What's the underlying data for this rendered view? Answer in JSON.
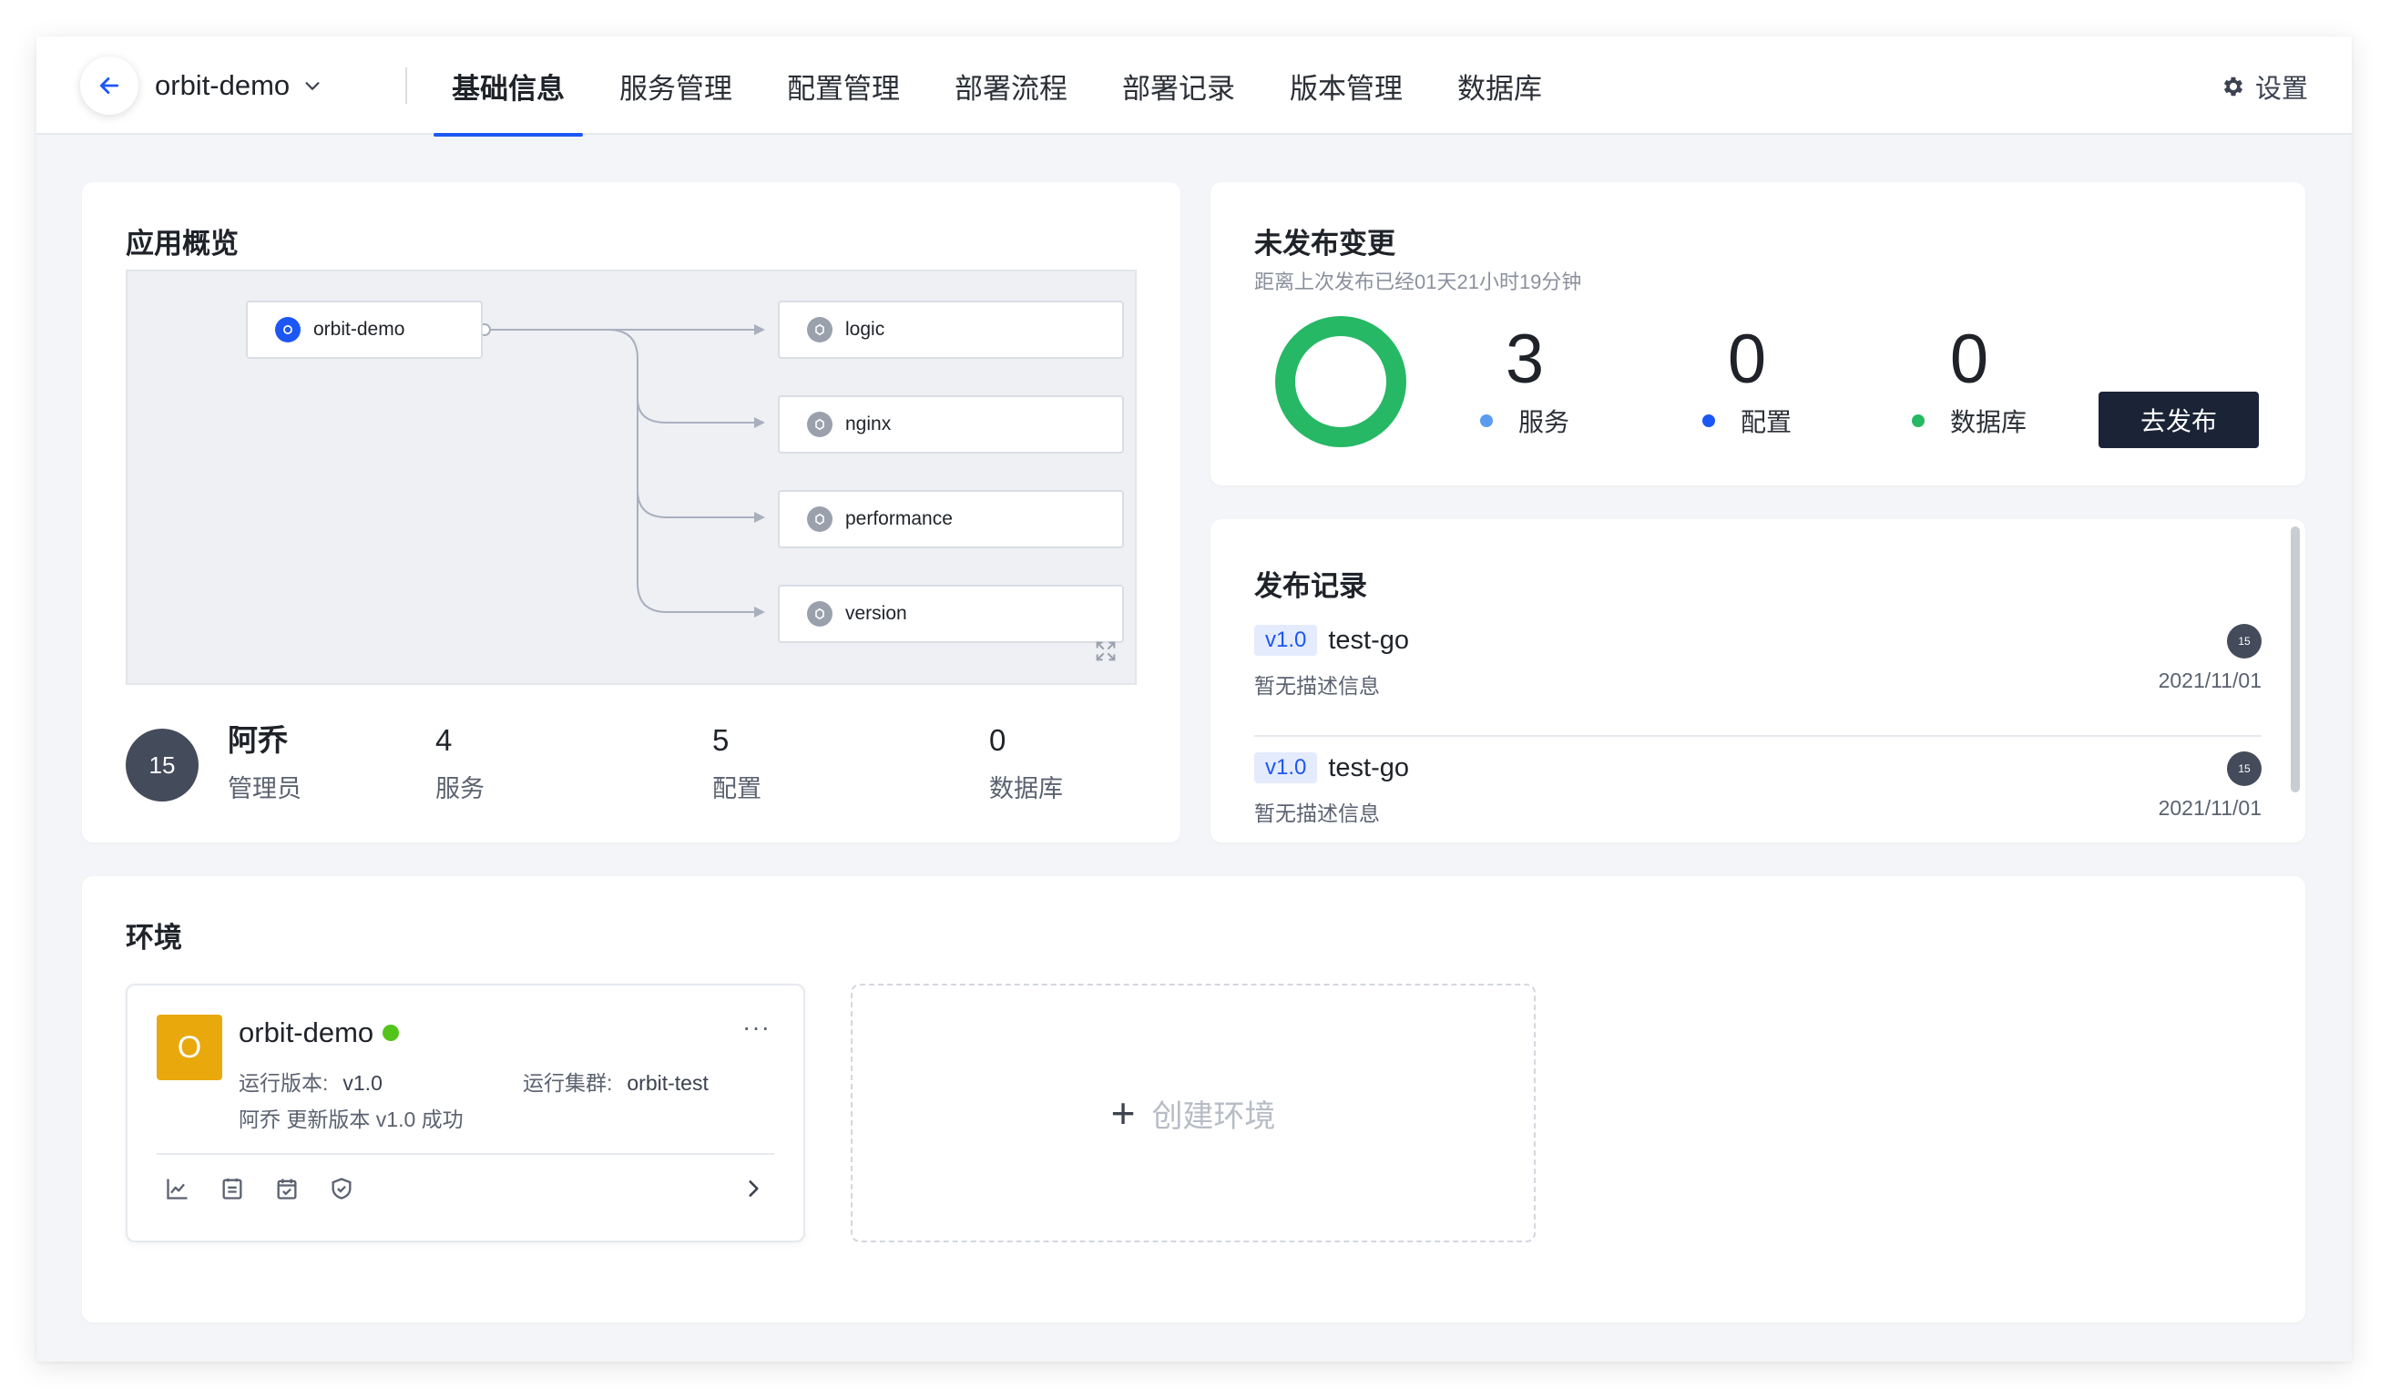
{
  "header": {
    "app_name": "orbit-demo",
    "tabs": [
      {
        "label": "基础信息",
        "active": true
      },
      {
        "label": "服务管理",
        "active": false
      },
      {
        "label": "配置管理",
        "active": false
      },
      {
        "label": "部署流程",
        "active": false
      },
      {
        "label": "部署记录",
        "active": false
      },
      {
        "label": "版本管理",
        "active": false
      },
      {
        "label": "数据库",
        "active": false
      }
    ],
    "settings_label": "设置"
  },
  "overview": {
    "title": "应用概览",
    "diagram": {
      "root": "orbit-demo",
      "children": [
        "logic",
        "nginx",
        "performance",
        "version"
      ]
    },
    "owner": {
      "avatar_text": "15",
      "name": "阿乔",
      "role": "管理员"
    },
    "stats": [
      {
        "value": "4",
        "label": "服务"
      },
      {
        "value": "5",
        "label": "配置"
      },
      {
        "value": "0",
        "label": "数据库"
      }
    ]
  },
  "unreleased": {
    "title": "未发布变更",
    "subtitle": "距离上次发布已经01天21小时19分钟",
    "stats": [
      {
        "value": "3",
        "label": "服务",
        "color": "#5b9cf0"
      },
      {
        "value": "0",
        "label": "配置",
        "color": "#1c57f5"
      },
      {
        "value": "0",
        "label": "数据库",
        "color": "#26b865"
      }
    ],
    "ring_color": "#26b865",
    "publish_button": "去发布"
  },
  "releases": {
    "title": "发布记录",
    "items": [
      {
        "version": "v1.0",
        "name": "test-go",
        "description": "暂无描述信息",
        "date": "2021/11/01",
        "avatar_text": "15"
      },
      {
        "version": "v1.0",
        "name": "test-go",
        "description": "暂无描述信息",
        "date": "2021/11/01",
        "avatar_text": "15"
      }
    ]
  },
  "environments": {
    "title": "环境",
    "env": {
      "badge": "O",
      "name": "orbit-demo",
      "version_label": "运行版本:",
      "version_value": "v1.0",
      "cluster_label": "运行集群:",
      "cluster_value": "orbit-test",
      "last_action": "阿乔 更新版本 v1.0 成功",
      "more_label": "···"
    },
    "create_label": "创建环境"
  }
}
